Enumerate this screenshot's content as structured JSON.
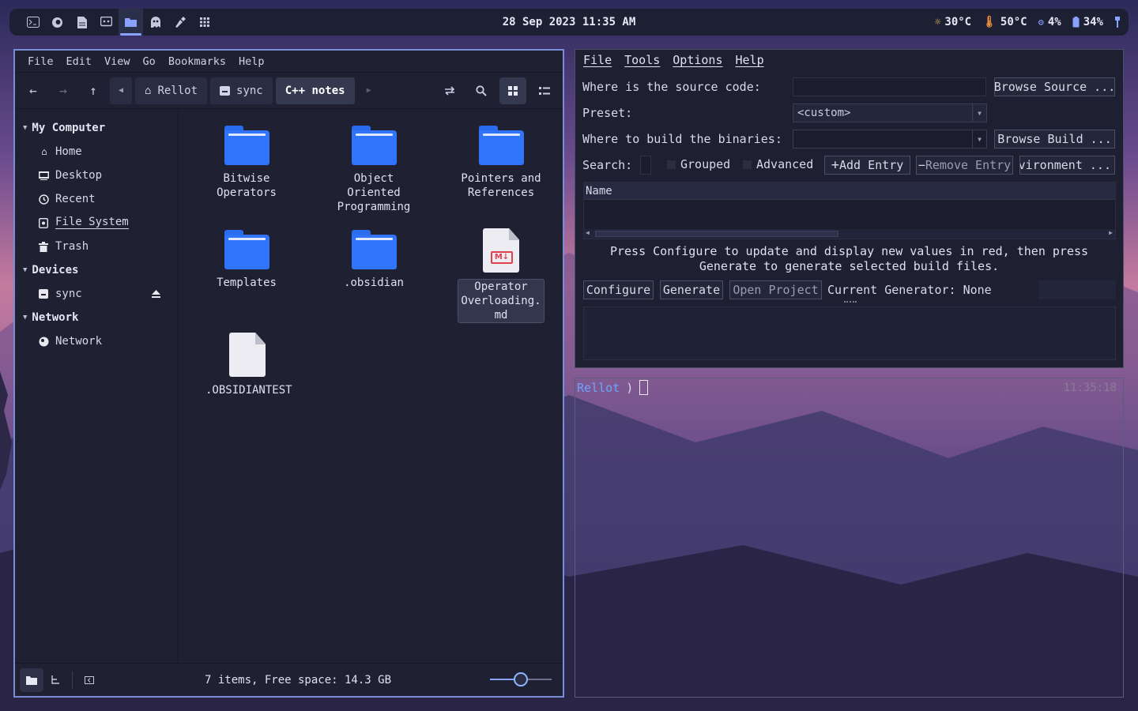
{
  "topbar": {
    "datetime": "28 Sep 2023 11:35 AM",
    "apps": [
      "terminal-icon",
      "firefox-icon",
      "document-icon",
      "discord-icon",
      "folder-icon",
      "ghost-icon",
      "brush-icon",
      "apps-grid-icon"
    ],
    "active_app": "folder-icon",
    "stats": {
      "weather": "30°C",
      "temperature": "50°C",
      "cpu": "4%",
      "battery": "34%"
    }
  },
  "file_manager": {
    "menu": [
      "File",
      "Edit",
      "View",
      "Go",
      "Bookmarks",
      "Help"
    ],
    "breadcrumbs": [
      "Rellot",
      "sync",
      "C++ notes"
    ],
    "active_crumb": "C++ notes",
    "sidebar": {
      "sections": [
        {
          "title": "My Computer",
          "items": [
            {
              "label": "Home",
              "icon": "home-icon"
            },
            {
              "label": "Desktop",
              "icon": "desktop-icon"
            },
            {
              "label": "Recent",
              "icon": "clock-icon"
            },
            {
              "label": "File System",
              "icon": "drive-icon",
              "underline": true
            },
            {
              "label": "Trash",
              "icon": "trash-icon"
            }
          ]
        },
        {
          "title": "Devices",
          "items": [
            {
              "label": "sync",
              "icon": "drive-icon",
              "eject": true
            }
          ]
        },
        {
          "title": "Network",
          "items": [
            {
              "label": "Network",
              "icon": "network-icon"
            }
          ]
        }
      ]
    },
    "files": [
      {
        "name": "Bitwise\nOperators",
        "type": "folder"
      },
      {
        "name": "Object\nOriented\nProgramming",
        "type": "folder"
      },
      {
        "name": "Pointers and\nReferences",
        "type": "folder"
      },
      {
        "name": "Templates",
        "type": "folder"
      },
      {
        "name": ".obsidian",
        "type": "folder"
      },
      {
        "name": "Operator\nOverloading.\nmd",
        "type": "markdown",
        "selected": true
      },
      {
        "name": ".OBSIDIANTEST",
        "type": "file"
      }
    ],
    "status": "7 items, Free space: 14.3 GB",
    "zoom_fraction": 0.5
  },
  "cmake": {
    "menu": [
      "File",
      "Tools",
      "Options",
      "Help"
    ],
    "source_label": "Where is the source code:",
    "source_value": "",
    "browse_source": "Browse Source ...",
    "preset_label": "Preset:",
    "preset_value": "<custom>",
    "build_label": "Where to build the binaries:",
    "build_value": "",
    "browse_build": "Browse Build ...",
    "search_label": "Search:",
    "grouped_label": "Grouped",
    "advanced_label": "Advanced",
    "add_entry": "Add Entry",
    "remove_entry": "Remove Entry",
    "environment": "Environment ...",
    "table_header": "Name",
    "message": "Press Configure to update and display new values in red, then press\nGenerate to generate selected build files.",
    "configure": "Configure",
    "generate": "Generate",
    "open_project": "Open Project",
    "current_generator": "Current Generator: None"
  },
  "terminal": {
    "prompt_user": "Rellot",
    "prompt_symbol": ")",
    "time": "11:35:18"
  }
}
